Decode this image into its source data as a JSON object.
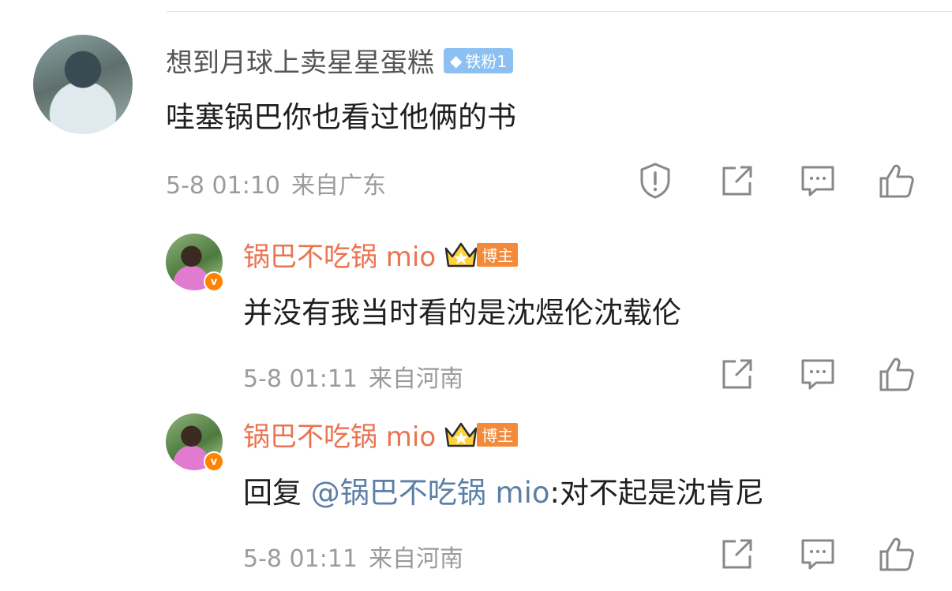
{
  "comment": {
    "username": "想到月球上卖星星蛋糕",
    "fan_badge": "铁粉1",
    "text": "哇塞锅巴你也看过他俩的书",
    "time": "5-8 01:10",
    "location": "来自广东"
  },
  "replies": [
    {
      "username": "锅巴不吃锅 mio",
      "verified_mark": "v",
      "role_badge": "博主",
      "text": "并没有我当时看的是沈煜伦沈载伦",
      "time": "5-8 01:11",
      "location": "来自河南"
    },
    {
      "username": "锅巴不吃锅 mio",
      "verified_mark": "v",
      "role_badge": "博主",
      "reply_prefix": "回复 ",
      "mention": "@锅巴不吃锅 mio",
      "reply_text": ":对不起是沈肯尼",
      "time": "5-8 01:11",
      "location": "来自河南"
    }
  ],
  "icons": [
    "report-icon",
    "share-icon",
    "comment-icon",
    "like-icon"
  ],
  "colors": {
    "blogger_name": "#eb7350",
    "mention": "#5b7fa6",
    "fan_badge": "#8cc0f2",
    "meta": "#9b9b9b"
  }
}
